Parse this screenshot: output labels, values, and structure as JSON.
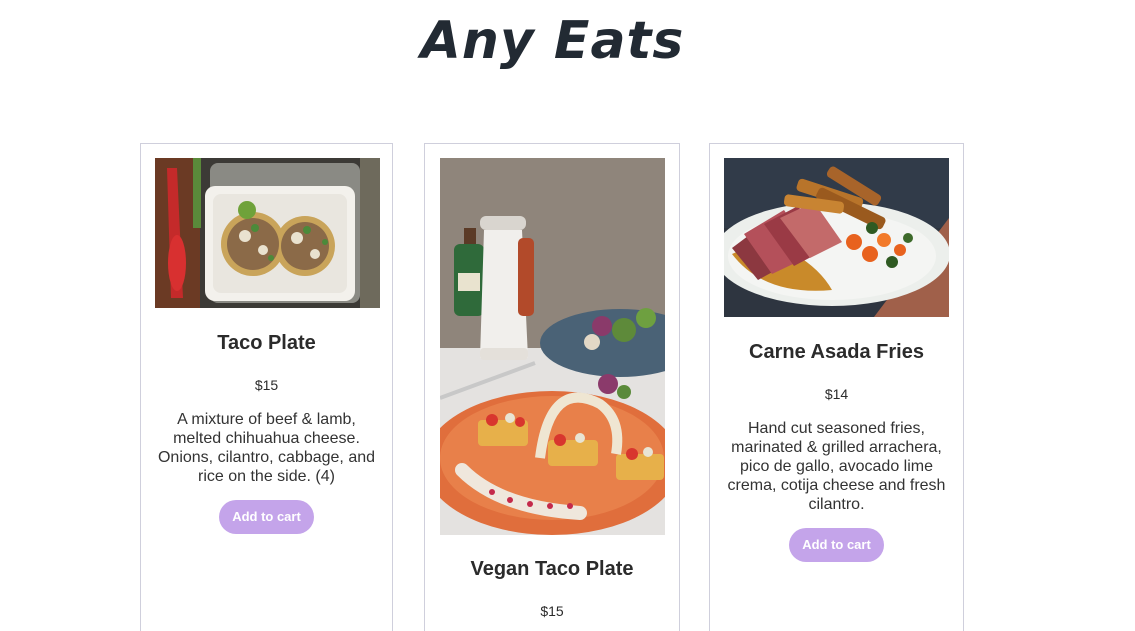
{
  "header": {
    "title": "Any Eats"
  },
  "menu": [
    {
      "name": "Taco Plate",
      "price": "$15",
      "description": "A mixture of beef & lamb, melted chihuahua cheese. Onions, cilantro, cabbage, and rice on the side. (4)",
      "button_label": "Add to cart"
    },
    {
      "name": "Vegan Taco Plate",
      "price": "$15",
      "description": "",
      "button_label": ""
    },
    {
      "name": "Carne Asada Fries",
      "price": "$14",
      "description": "Hand cut seasoned fries, marinated & grilled arrachera, pico de gallo, avocado lime crema, cotija cheese and fresh cilantro.",
      "button_label": "Add to cart"
    }
  ],
  "colors": {
    "button_bg": "#c4a4ea",
    "card_border": "#cfcfdc",
    "text": "#2b2b2b"
  }
}
